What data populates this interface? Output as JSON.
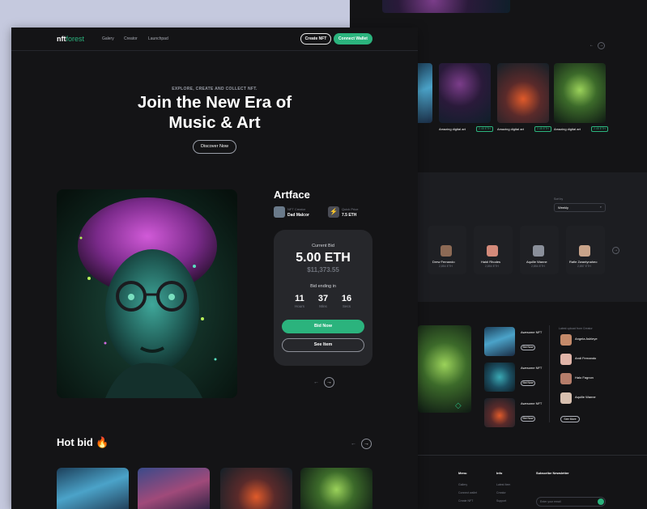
{
  "nav": {
    "logo_a": "nft",
    "logo_b": "forest",
    "links": [
      "Galery",
      "Creator",
      "Launchpad"
    ],
    "create_label": "Create NFT",
    "connect_label": "Connect Wallet"
  },
  "hero": {
    "kicker": "EXPLORE, CREATE AND COLLECT NFT.",
    "title_line1": "Join the New Era of",
    "title_line2": "Music & Art",
    "discover_label": "Discover Now"
  },
  "featured": {
    "title": "Artface",
    "creator_label": "NFT Creator",
    "creator_name": "Dad Malcor",
    "price_label": "Quick Price",
    "price_value": "7.5 ETH",
    "bid_label": "Current Bid",
    "bid_value": "5.00 ETH",
    "bid_usd": "$11,373.55",
    "ending_label": "Bid ending in",
    "countdown": [
      {
        "value": "11",
        "unit": "Hours"
      },
      {
        "value": "37",
        "unit": "Mins"
      },
      {
        "value": "16",
        "unit": "Secs"
      }
    ],
    "bid_now_label": "Bid Now",
    "see_item_label": "See Item"
  },
  "hot_bid": {
    "title": "Hot bid 🔥"
  },
  "back_page": {
    "cards": [
      {
        "name": "Amazing digital art",
        "price": "2.45 ETH"
      },
      {
        "name": "Amazing digital art",
        "price": "2.45 ETH"
      },
      {
        "name": "Amazing digital art",
        "price": "2.45 ETH"
      }
    ],
    "sort_label": "Sort by",
    "sort_value": "Weekly",
    "creators": [
      {
        "name": "Drew Fernando",
        "eth": "2,854 ETH"
      },
      {
        "name": "Haldi Rhodes",
        "eth": "2,854 ETH"
      },
      {
        "name": "Aquille Wanne",
        "eth": "2,854 ETH"
      },
      {
        "name": "Rafie Zwantynaheo",
        "eth": "2,857 ETH"
      }
    ],
    "awesome": [
      {
        "name": "Awesome NFT",
        "bid": "Bid Now"
      },
      {
        "name": "Awesome NFT",
        "bid": "Bid Now"
      },
      {
        "name": "Awesome NFT",
        "bid": "Bid Now"
      }
    ],
    "latest_label": "Latest upload from Creator",
    "latest": [
      "Angela Ashleye",
      "Andi Fernando",
      "Halo Fagnon",
      "Aquille Wanne"
    ],
    "see_more": "See More",
    "footer_cols": [
      "Menu",
      "Info",
      "Subscribe Newsletter"
    ],
    "footer_menu": [
      "Gallery",
      "Connect wallet",
      "Create NFT"
    ],
    "footer_info": [
      "Latest Item",
      "Creator",
      "Support"
    ],
    "email_placeholder": "Enter your email"
  },
  "colors": {
    "accent": "#2bb37d",
    "bg": "#141416",
    "card": "#26272b",
    "frame": "#c5c9de"
  }
}
